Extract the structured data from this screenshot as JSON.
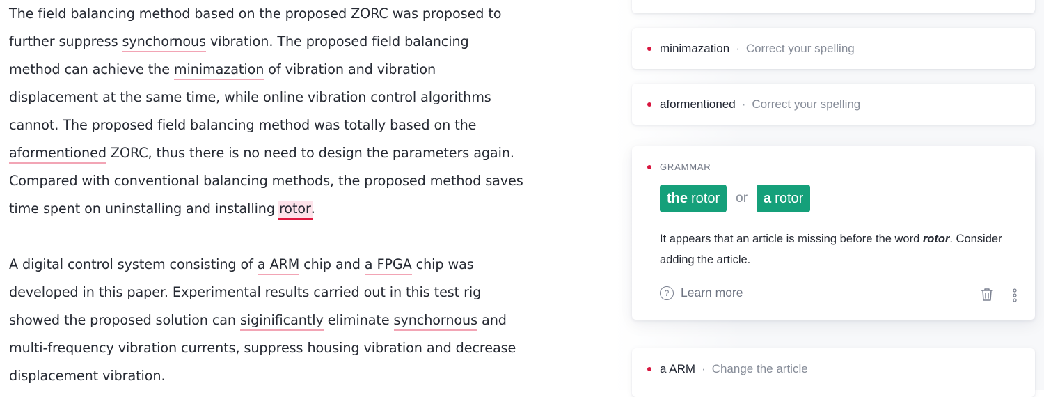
{
  "editor": {
    "p1": {
      "t1": "The field balancing method based on the proposed ZORC was proposed to further suppress ",
      "e1": "synchornous",
      "t2": " vibration. The proposed field balancing method can achieve the ",
      "e2": "minimazation",
      "t3": " of vibration and vibration displacement at the same time, while online vibration control algorithms cannot. The proposed field balancing method was totally based on the ",
      "e3": "aformentioned",
      "t4": " ZORC, thus there is no need to design the parameters again. Compared with conventional balancing methods, the proposed method saves time spent on uninstalling and installing ",
      "e4": "rotor",
      "t5": "."
    },
    "p2": {
      "t1": "A digital control system consisting of ",
      "e1": "a ARM",
      "t2": " chip and ",
      "e2": "a FPGA",
      "t3": " chip was developed in this paper. Experimental results carried out in this test rig showed the proposed solution can ",
      "e3": "siginificantly",
      "t4": " eliminate ",
      "e4": "synchornous",
      "t5": " and multi-frequency vibration currents, suppress housing vibration and decrease displacement vibration."
    }
  },
  "cards": {
    "c1": {
      "word": "minimazation",
      "sep": "·",
      "hint": "Correct your spelling"
    },
    "c2": {
      "word": "aformentioned",
      "sep": "·",
      "hint": "Correct your spelling"
    },
    "expanded": {
      "category": "GRAMMAR",
      "s1_bold": "the",
      "s1_rest": "rotor",
      "or": "or",
      "s2_bold": "a",
      "s2_rest": "rotor",
      "desc_pre": "It appears that an article is missing before the word ",
      "desc_word": "rotor",
      "desc_post": ". Consider adding the article.",
      "learn": "Learn more",
      "help_glyph": "?"
    },
    "c3": {
      "word": "a ARM",
      "sep": "·",
      "hint": "Change the article"
    }
  },
  "colors": {
    "error": "#d8163f",
    "underline": "#f2a5b5",
    "accent": "#15a07a"
  },
  "icons": [
    "question-circle-icon",
    "trash-icon",
    "more-vertical-icon"
  ]
}
